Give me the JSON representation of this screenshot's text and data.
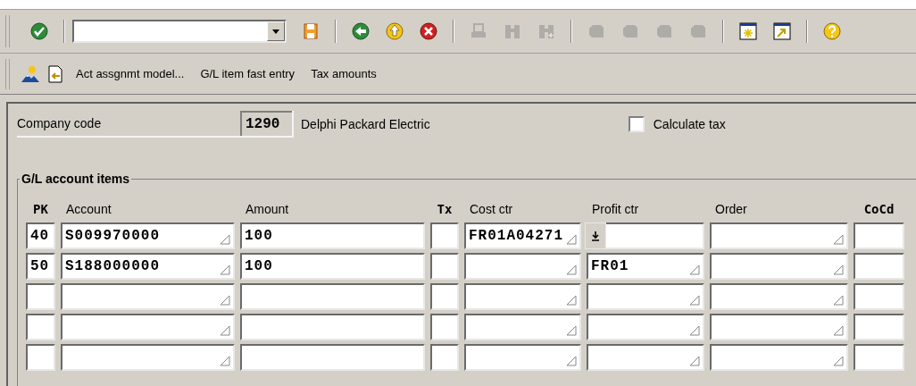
{
  "toolbar": [
    {
      "kind": "check",
      "disabled": false
    },
    {
      "kind": "separator"
    },
    {
      "kind": "command_field"
    },
    {
      "kind": "save",
      "disabled": false
    },
    {
      "kind": "separator"
    },
    {
      "kind": "back",
      "disabled": false
    },
    {
      "kind": "exit",
      "disabled": false
    },
    {
      "kind": "cancel",
      "disabled": false
    },
    {
      "kind": "separator"
    },
    {
      "kind": "print",
      "disabled": true
    },
    {
      "kind": "find",
      "disabled": true
    },
    {
      "kind": "find_next",
      "disabled": true
    },
    {
      "kind": "separator"
    },
    {
      "kind": "first_page",
      "disabled": true
    },
    {
      "kind": "prev_page",
      "disabled": true
    },
    {
      "kind": "next_page",
      "disabled": true
    },
    {
      "kind": "last_page",
      "disabled": true
    },
    {
      "kind": "separator"
    },
    {
      "kind": "new_session",
      "disabled": false
    },
    {
      "kind": "shortcut",
      "disabled": false
    },
    {
      "kind": "separator"
    },
    {
      "kind": "help",
      "disabled": false
    }
  ],
  "app_toolbar": [
    {
      "kind": "landscape"
    },
    {
      "kind": "import"
    },
    {
      "kind": "text",
      "label": "Act assgnmt model..."
    },
    {
      "kind": "text",
      "label": "G/L item fast entry"
    },
    {
      "kind": "text",
      "label": "Tax amounts"
    }
  ],
  "company_code": {
    "label": "Company code",
    "value": "1290",
    "name": "Delphi Packard Electric"
  },
  "calculate_tax": {
    "label": "Calculate tax",
    "checked": false
  },
  "group": {
    "title": "G/L account items"
  },
  "columns": [
    {
      "label": "PK",
      "bold": true
    },
    {
      "label": "Account",
      "bold": false
    },
    {
      "label": "Amount",
      "bold": false
    },
    {
      "label": "Tx",
      "bold": true
    },
    {
      "label": "Cost ctr",
      "bold": false
    },
    {
      "label": "Profit ctr",
      "bold": false
    },
    {
      "label": "Order",
      "bold": false
    },
    {
      "label": "CoCd",
      "bold": true
    }
  ],
  "rows": [
    {
      "cells": [
        "40",
        "S009970000",
        "100",
        "",
        "FR01A04271",
        "",
        "",
        ""
      ],
      "value_help": true
    },
    {
      "cells": [
        "50",
        "S188000000",
        "100",
        "",
        "",
        "FR01",
        "",
        ""
      ],
      "value_help": false
    },
    {
      "cells": [
        "",
        "",
        "",
        "",
        "",
        "",
        "",
        ""
      ],
      "value_help": false
    },
    {
      "cells": [
        "",
        "",
        "",
        "",
        "",
        "",
        "",
        ""
      ],
      "value_help": false
    },
    {
      "cells": [
        "",
        "",
        "",
        "",
        "",
        "",
        "",
        ""
      ],
      "value_help": false
    }
  ]
}
